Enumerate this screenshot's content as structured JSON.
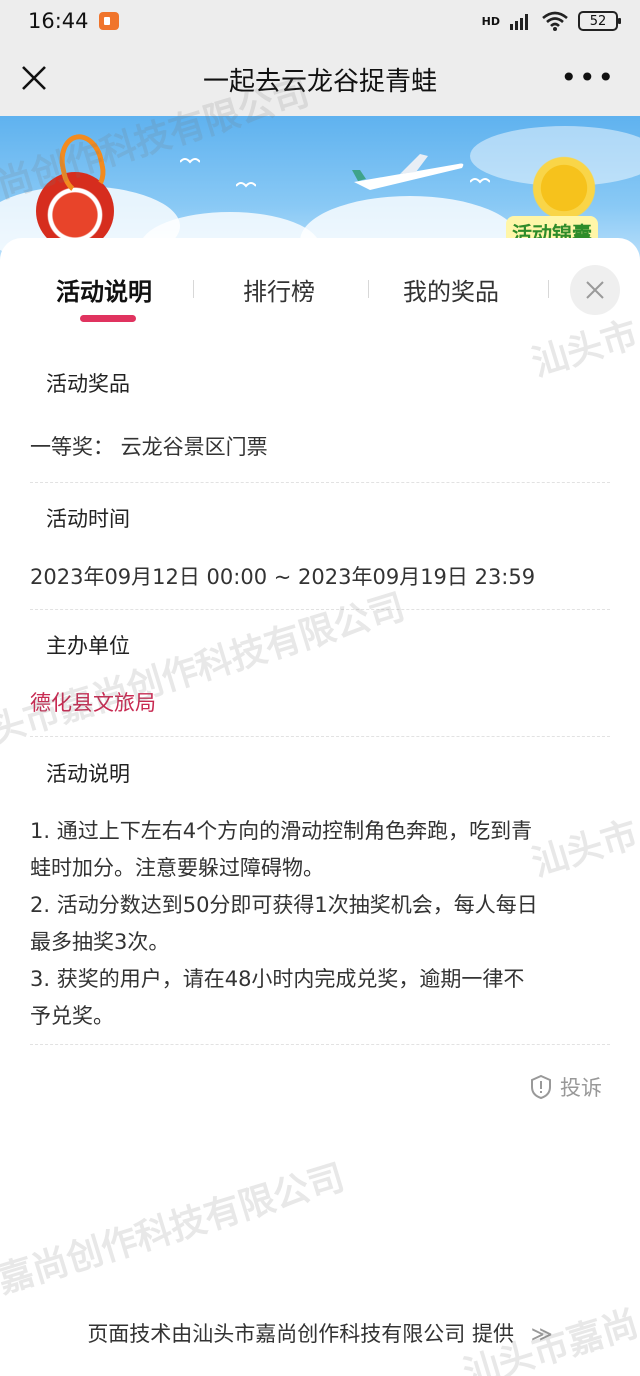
{
  "status_bar": {
    "time": "16:44",
    "network_label": "HD",
    "battery": "52"
  },
  "nav": {
    "title": "一起去云龙谷捉青蛙"
  },
  "banner": {
    "tag_text": "活动锦囊"
  },
  "tabs": [
    {
      "label": "活动说明",
      "active": true
    },
    {
      "label": "排行榜",
      "active": false
    },
    {
      "label": "我的奖品",
      "active": false
    }
  ],
  "sections": {
    "prize": {
      "title": "活动奖品",
      "content": "一等奖： 云龙谷景区门票"
    },
    "time": {
      "title": "活动时间",
      "content": "2023年09月12日 00:00 ~ 2023年09月19日 23:59"
    },
    "organizer": {
      "title": "主办单位",
      "content": "德化县文旅局"
    },
    "description": {
      "title": "活动说明",
      "lines": [
        "1. 通过上下左右4个方向的滑动控制角色奔跑，吃到青",
        "蛙时加分。注意要躲过障碍物。",
        "2. 活动分数达到50分即可获得1次抽奖机会，每人每日",
        "最多抽奖3次。",
        "3. 获奖的用户，请在48小时内完成兑奖，逾期一律不",
        "予兑奖。"
      ]
    }
  },
  "complain_label": "投诉",
  "footer": {
    "text": "页面技术由汕头市嘉尚创作科技有限公司 提供",
    "arrows": "≫"
  },
  "watermarks": {
    "full": "汕头市嘉尚创作科技有限公司",
    "w1": "尚创作科技有限公司",
    "w2": "汕头市",
    "w3": "头市嘉尚创作科技有限公司",
    "w4": "汕头市",
    "w5": "嘉尚创作科技有限公司",
    "w6": "汕头市嘉尚"
  },
  "colors": {
    "accent": "#e0335f",
    "organizer_text": "#c82a52",
    "nav_bg": "#ededed"
  }
}
